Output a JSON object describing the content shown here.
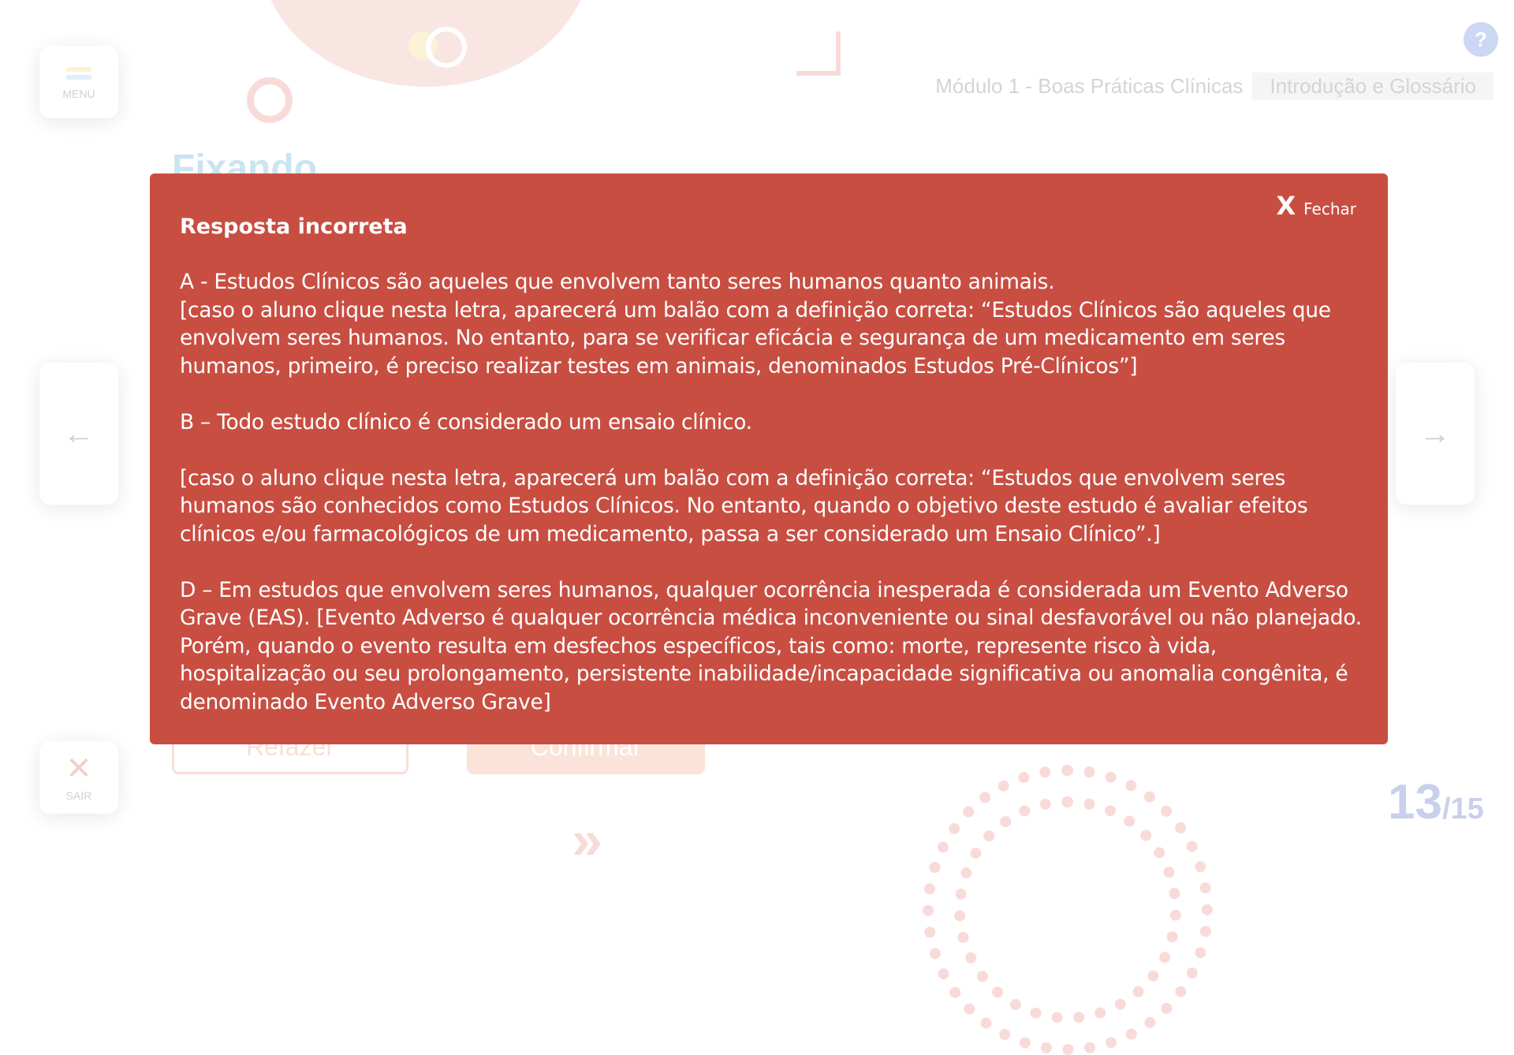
{
  "header": {
    "menu_label": "MENU",
    "help_label": "?",
    "module": "Módulo 1 - Boas Práticas Clínicas",
    "section": "Introdução e Glossário"
  },
  "page": {
    "heading": "Fixando",
    "redo_label": "Refazer",
    "confirm_label": "Confirmar",
    "exit_label": "SAIR",
    "exit_icon": "✕",
    "prev_icon": "←",
    "next_icon": "→",
    "current_page": "13",
    "total_pages": "/15"
  },
  "modal": {
    "close_icon": "X",
    "close_label": "Fechar",
    "title": "Resposta incorreta",
    "option_a": "A - Estudos Clínicos são aqueles que envolvem tanto seres humanos quanto animais.",
    "option_a_feedback": "[caso o aluno clique nesta letra, aparecerá um balão com a definição correta: “Estudos Clínicos são aqueles que envolvem seres humanos. No entanto, para se verificar eficácia e segurança de um medicamento em seres humanos, primeiro, é preciso realizar testes em animais, denominados Estudos Pré-Clínicos”]",
    "option_b": "B – Todo estudo clínico é considerado um ensaio clínico.",
    "option_b_feedback": "[caso o aluno clique nesta letra, aparecerá um balão com a definição correta: “Estudos que envolvem seres humanos são conhecidos como Estudos Clínicos. No entanto, quando o objetivo deste estudo é avaliar efeitos clínicos e/ou farmacológicos de um medicamento, passa a ser considerado um Ensaio Clínico”.]",
    "option_d": "D – Em estudos que envolvem seres humanos, qualquer ocorrência inesperada é considerada um Evento Adverso Grave (EAS).  [Evento Adverso é qualquer ocorrência médica inconveniente ou sinal desfavorável ou não planejado. Porém, quando o evento resulta em desfechos específicos, tais como: morte, represente risco à vida, hospitalização ou seu prolongamento, persistente inabilidade/incapacidade significativa ou anomalia congênita, é denominado Evento Adverso Grave]"
  },
  "colors": {
    "modal_bg": "#c84e42",
    "accent_blue": "#4a6fd8",
    "accent_orange": "#ef9c78"
  }
}
